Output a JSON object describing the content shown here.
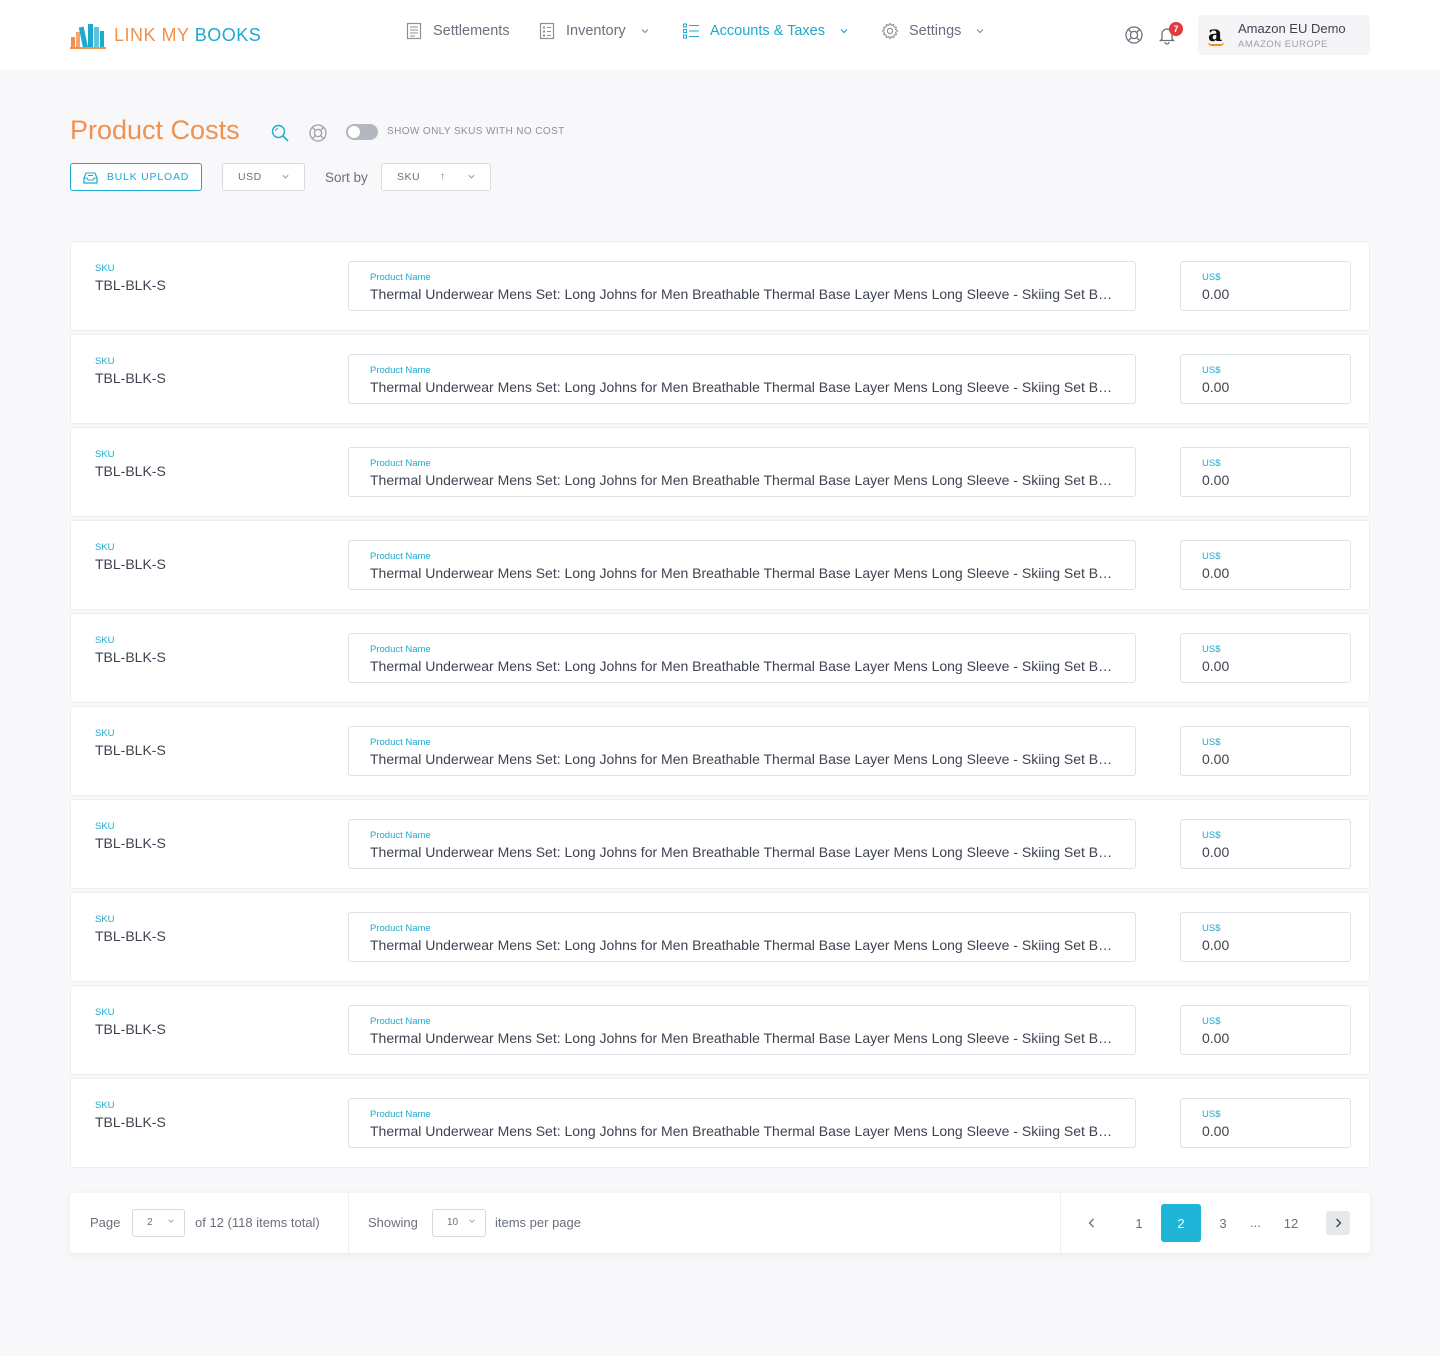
{
  "brand": {
    "word1": "LINK MY",
    "word2": "BOOKS"
  },
  "nav": {
    "settlements": "Settlements",
    "inventory": "Inventory",
    "accounts_taxes": "Accounts & Taxes",
    "settings": "Settings"
  },
  "notifications": {
    "count": "7"
  },
  "account": {
    "name": "Amazon EU Demo",
    "region": "AMAZON EUROPE",
    "logo_letter": "a"
  },
  "page": {
    "title": "Product Costs",
    "toggle_label": "SHOW ONLY SKUS WITH NO COST",
    "bulk_upload": "BULK UPLOAD",
    "currency": "USD",
    "sort_by_label": "Sort by",
    "sort_field": "SKU",
    "sort_direction_glyph": "↑"
  },
  "products": [
    {
      "sku_label": "SKU",
      "sku": "TBL-BLK-S",
      "name_label": "Product Name",
      "name": "Thermal Underwear Mens Set: Long Johns for Men Breathable Thermal Base Layer Mens Long Sleeve - Skiing Set Black Small",
      "cost_label": "US$",
      "cost": "0.00"
    },
    {
      "sku_label": "SKU",
      "sku": "TBL-BLK-S",
      "name_label": "Product Name",
      "name": "Thermal Underwear Mens Set: Long Johns for Men Breathable Thermal Base Layer Mens Long Sleeve - Skiing Set Black Small",
      "cost_label": "US$",
      "cost": "0.00"
    },
    {
      "sku_label": "SKU",
      "sku": "TBL-BLK-S",
      "name_label": "Product Name",
      "name": "Thermal Underwear Mens Set: Long Johns for Men Breathable Thermal Base Layer Mens Long Sleeve - Skiing Set Black Small",
      "cost_label": "US$",
      "cost": "0.00"
    },
    {
      "sku_label": "SKU",
      "sku": "TBL-BLK-S",
      "name_label": "Product Name",
      "name": "Thermal Underwear Mens Set: Long Johns for Men Breathable Thermal Base Layer Mens Long Sleeve - Skiing Set Black Small",
      "cost_label": "US$",
      "cost": "0.00"
    },
    {
      "sku_label": "SKU",
      "sku": "TBL-BLK-S",
      "name_label": "Product Name",
      "name": "Thermal Underwear Mens Set: Long Johns for Men Breathable Thermal Base Layer Mens Long Sleeve - Skiing Set Black Small",
      "cost_label": "US$",
      "cost": "0.00"
    },
    {
      "sku_label": "SKU",
      "sku": "TBL-BLK-S",
      "name_label": "Product Name",
      "name": "Thermal Underwear Mens Set: Long Johns for Men Breathable Thermal Base Layer Mens Long Sleeve - Skiing Set Black Small",
      "cost_label": "US$",
      "cost": "0.00"
    },
    {
      "sku_label": "SKU",
      "sku": "TBL-BLK-S",
      "name_label": "Product Name",
      "name": "Thermal Underwear Mens Set: Long Johns for Men Breathable Thermal Base Layer Mens Long Sleeve - Skiing Set Black Small",
      "cost_label": "US$",
      "cost": "0.00"
    },
    {
      "sku_label": "SKU",
      "sku": "TBL-BLK-S",
      "name_label": "Product Name",
      "name": "Thermal Underwear Mens Set: Long Johns for Men Breathable Thermal Base Layer Mens Long Sleeve - Skiing Set Black Small",
      "cost_label": "US$",
      "cost": "0.00"
    },
    {
      "sku_label": "SKU",
      "sku": "TBL-BLK-S",
      "name_label": "Product Name",
      "name": "Thermal Underwear Mens Set: Long Johns for Men Breathable Thermal Base Layer Mens Long Sleeve - Skiing Set Black Small",
      "cost_label": "US$",
      "cost": "0.00"
    },
    {
      "sku_label": "SKU",
      "sku": "TBL-BLK-S",
      "name_label": "Product Name",
      "name": "Thermal Underwear Mens Set: Long Johns for Men Breathable Thermal Base Layer Mens Long Sleeve - Skiing Set Black Small",
      "cost_label": "US$",
      "cost": "0.00"
    }
  ],
  "pagination": {
    "page_label": "Page",
    "current_page": "2",
    "of_total": "of 12 (118 items total)",
    "showing_label": "Showing",
    "per_page": "10",
    "per_page_label": "items per page",
    "pages": [
      "1",
      "2",
      "3",
      "12"
    ],
    "ellipsis": "...",
    "active_page": "2"
  },
  "colors": {
    "brand_orange": "#f0914e",
    "brand_blue": "#1fa9cf",
    "active_page_bg": "#1fb5d8",
    "badge_red": "#e0393e"
  },
  "icons": [
    "settlements-icon",
    "inventory-icon",
    "accounts-list-icon",
    "settings-gear-icon",
    "help-lifebuoy-icon",
    "bell-icon",
    "search-icon",
    "lifebuoy-icon",
    "upload-tray-icon",
    "chevron-left-icon",
    "chevron-right-icon"
  ]
}
